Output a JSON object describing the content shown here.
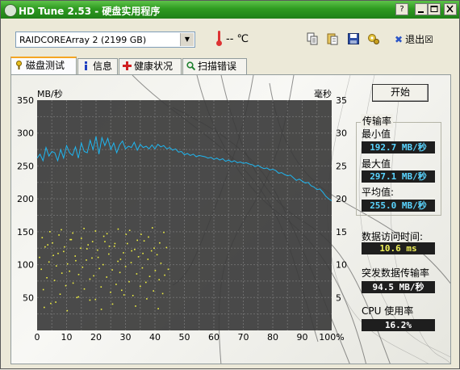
{
  "window": {
    "title": "HD Tune 2.53 - 硬盘实用程序",
    "minimize_icon": "minimize-glyph",
    "restore_icon": "restore-glyph",
    "close_icon": "close-glyph",
    "help_glyph": "?"
  },
  "toolbar": {
    "drive": "RAIDCOREArray 2  (2199 GB)",
    "temperature": "-- ℃",
    "exit_label": "退出",
    "icons": [
      "copy-icon",
      "copy-text-icon",
      "save-icon",
      "options-icon",
      "exit-icon"
    ]
  },
  "tabs": [
    {
      "label": "磁盘测试",
      "active": true,
      "icon": "benchmark-icon"
    },
    {
      "label": "信息",
      "active": false,
      "icon": "info-icon"
    },
    {
      "label": "健康状况",
      "active": false,
      "icon": "health-icon"
    },
    {
      "label": "扫描错误",
      "active": false,
      "icon": "scan-icon"
    }
  ],
  "side_panel": {
    "start_label": "开始",
    "transfer_rate_label": "传输率",
    "min_label": "最小值",
    "min_value": "192.7 MB/秒",
    "max_label": "最大值",
    "max_value": "297.1 MB/秒",
    "avg_label": "平均值:",
    "avg_value": "255.0 MB/秒",
    "access_label": "数据访问时间:",
    "access_value": "10.6 ms",
    "burst_label": "突发数据传输率",
    "burst_value": "94.5 MB/秒",
    "cpu_label": "CPU 使用率",
    "cpu_value": "16.2%"
  },
  "chart_data": {
    "type": "line",
    "left_axis_label": "MB/秒",
    "right_axis_label": "毫秒",
    "y_left_ticks": [
      "350",
      "300",
      "250",
      "200",
      "150",
      "100",
      "50"
    ],
    "y_left_range": [
      0,
      350
    ],
    "y_right_ticks": [
      "35",
      "30",
      "25",
      "20",
      "15",
      "10",
      "5"
    ],
    "y_right_range": [
      0,
      35
    ],
    "x_ticks": [
      "0",
      "10",
      "20",
      "30",
      "40",
      "50",
      "60",
      "70",
      "80",
      "90",
      "100%"
    ],
    "x_range": [
      0,
      100
    ],
    "grid": true,
    "transfer_color": "#1fb6f0",
    "access_color": "#f0f040",
    "series": [
      {
        "name": "transfer_rate",
        "unit": "MB/秒",
        "x": [
          0,
          1,
          2,
          3,
          4,
          5,
          6,
          7,
          8,
          9,
          10,
          11,
          12,
          13,
          14,
          15,
          16,
          17,
          18,
          19,
          20,
          21,
          22,
          23,
          24,
          25,
          26,
          27,
          28,
          29,
          30,
          31,
          32,
          33,
          34,
          35,
          36,
          37,
          38,
          39,
          40,
          41,
          42,
          43,
          44,
          45,
          46,
          47,
          48,
          49,
          50,
          51,
          52,
          53,
          54,
          55,
          56,
          57,
          58,
          59,
          60,
          61,
          62,
          63,
          64,
          65,
          66,
          67,
          68,
          69,
          70,
          71,
          72,
          73,
          74,
          75,
          76,
          77,
          78,
          79,
          80,
          81,
          82,
          83,
          84,
          85,
          86,
          87,
          88,
          89,
          90,
          91,
          92,
          93,
          94,
          95,
          96,
          97,
          98,
          99,
          100
        ],
        "y": [
          262,
          268,
          258,
          278,
          265,
          272,
          270,
          258,
          275,
          262,
          281,
          270,
          266,
          279,
          262,
          285,
          272,
          270,
          289,
          275,
          295,
          268,
          293,
          281,
          292,
          275,
          285,
          270,
          282,
          288,
          276,
          280,
          278,
          286,
          274,
          283,
          278,
          280,
          276,
          282,
          276,
          283,
          279,
          281,
          276,
          278,
          274,
          276,
          271,
          272,
          267,
          269,
          266,
          268,
          264,
          266,
          265,
          264,
          262,
          263,
          260,
          262,
          259,
          261,
          257,
          259,
          256,
          258,
          255,
          256,
          254,
          255,
          253,
          252,
          249,
          251,
          248,
          246,
          247,
          244,
          245,
          243,
          239,
          240,
          237,
          235,
          236,
          232,
          228,
          230,
          227,
          224,
          225,
          220,
          218,
          214,
          215,
          210,
          204,
          200,
          197
        ]
      },
      {
        "name": "access_time",
        "unit": "毫秒",
        "x": [
          0.6,
          1.2,
          1.9,
          2.5,
          3.1,
          3.8,
          4.4,
          5,
          5.7,
          6.3,
          6.9,
          7.6,
          8.2,
          8.8,
          9.5,
          10.1,
          10.8,
          11.4,
          12,
          12.7,
          13.3,
          13.9,
          14.6,
          15.2,
          15.8,
          16.5,
          17.1,
          17.7,
          18.4,
          19,
          19.6,
          20.3,
          20.9,
          21.5,
          22.2,
          22.8,
          23.4,
          24.1,
          24.7,
          25.3,
          26,
          26.6,
          27.2,
          27.9,
          28.5,
          29.1,
          29.8,
          30.4,
          31,
          31.7,
          32.3,
          32.9,
          33.6,
          34.2,
          34.8,
          35.5,
          36.1,
          36.7,
          37.4,
          38,
          38.6,
          39.3,
          39.9,
          40.5,
          41.2,
          41.8,
          42.4,
          43.1,
          43.7,
          44.3,
          1.5,
          3.4,
          5.3,
          7.2,
          9.1,
          11,
          12.9,
          14.8,
          16.7,
          18.6,
          20.5,
          22.4,
          24.3,
          26.2,
          28.1,
          30,
          31.9,
          33.8,
          35.7,
          37.6,
          39.5,
          41.4,
          2.2,
          6.1,
          10,
          13.8,
          17.7,
          21.6,
          25.4,
          29.3,
          33.2,
          37,
          40.9,
          4.1,
          8,
          11.9,
          15.7,
          19.6,
          23.5,
          27.3,
          31.2,
          35.1,
          38.9,
          42.8
        ],
        "y": [
          11.2,
          9.4,
          6.3,
          12.8,
          8.1,
          10.5,
          4.2,
          13.4,
          7.7,
          9.9,
          11.8,
          5.6,
          8.8,
          12.1,
          6.9,
          10.2,
          9.1,
          13.9,
          7.3,
          11.4,
          5.1,
          8.6,
          12.6,
          9.7,
          6.4,
          10.8,
          13.1,
          7.9,
          11.1,
          8.4,
          4.8,
          12.3,
          9.5,
          6.7,
          10.1,
          13.6,
          8.2,
          11.7,
          5.9,
          9.3,
          12.9,
          7.1,
          10.6,
          8.9,
          6.2,
          11.9,
          9.8,
          13.3,
          7.5,
          10.4,
          5.4,
          12.4,
          8.7,
          11.3,
          6.8,
          9.6,
          13.7,
          7.4,
          10.9,
          8.3,
          12.2,
          6.1,
          9.2,
          11.6,
          7.8,
          10.3,
          5.7,
          8.5,
          12.7,
          9.4,
          14.2,
          13.1,
          11.5,
          14.6,
          12.8,
          13.9,
          10.7,
          14.1,
          12.5,
          13.6,
          11.2,
          14.4,
          12.9,
          13.3,
          10.9,
          14.7,
          12.2,
          13.8,
          11.8,
          14.3,
          12.6,
          13.4,
          3.6,
          4.4,
          3.1,
          5.2,
          4.7,
          3.3,
          4.1,
          5.5,
          3.8,
          4.9,
          3.4,
          15.1,
          15.4,
          14.9,
          15.6,
          15.2,
          14.8,
          15.5,
          15.3,
          14.7,
          15.7,
          15
        ]
      }
    ]
  }
}
